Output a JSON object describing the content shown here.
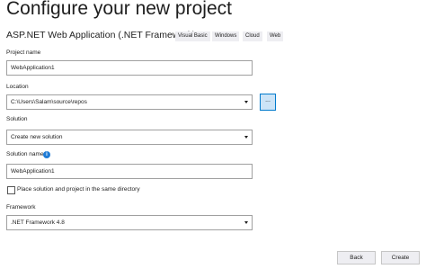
{
  "page": {
    "title": "Configure your new project",
    "project_type": "ASP.NET Web Application (.NET Framework)",
    "tags": [
      "Visual Basic",
      "Windows",
      "Cloud",
      "Web"
    ]
  },
  "form": {
    "project_name_label": "Project name",
    "project_name_value": "WebApplication1",
    "location_label": "Location",
    "location_value": "C:\\Users\\Salam\\source\\repos",
    "browse_label": "...",
    "solution_label": "Solution",
    "solution_value": "Create new solution",
    "solution_name_label": "Solution name",
    "solution_name_value": "WebApplication1",
    "same_directory_label": "Place solution and project in the same directory",
    "same_directory_checked": false,
    "framework_label": "Framework",
    "framework_value": ".NET Framework 4.8"
  },
  "icons": {
    "info": "info-icon",
    "dropdown": "chevron-down-icon"
  },
  "footer": {
    "back_label": "Back",
    "create_label": "Create"
  },
  "colors": {
    "accent": "#007acc",
    "browse_bg": "#cce4f7",
    "info": "#1e7bd6"
  }
}
